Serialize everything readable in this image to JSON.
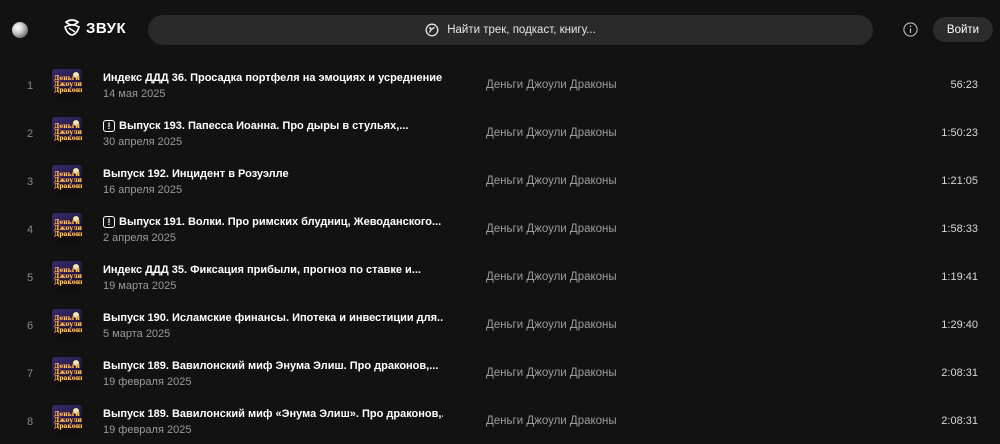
{
  "header": {
    "logo_text": "ЗВУК",
    "search_placeholder": "Найти трек, подкаст, книгу...",
    "login_label": "Войти"
  },
  "tracks": [
    {
      "num": "1",
      "title": "Индекс ДДД 36. Просадка портфеля на эмоциях и усреднение",
      "explicit": false,
      "date": "14 мая 2025",
      "artist": "Деньги Джоули Драконы",
      "duration": "56:23"
    },
    {
      "num": "2",
      "title": "Выпуск 193. Папесса Иоанна. Про дыры в стульях,...",
      "explicit": true,
      "date": "30 апреля 2025",
      "artist": "Деньги Джоули Драконы",
      "duration": "1:50:23"
    },
    {
      "num": "3",
      "title": "Выпуск 192. Инцидент в Розуэлле",
      "explicit": false,
      "date": "16 апреля 2025",
      "artist": "Деньги Джоули Драконы",
      "duration": "1:21:05"
    },
    {
      "num": "4",
      "title": "Выпуск 191. Волки. Про римских блудниц, Жеводанского...",
      "explicit": true,
      "date": "2 апреля 2025",
      "artist": "Деньги Джоули Драконы",
      "duration": "1:58:33"
    },
    {
      "num": "5",
      "title": "Индекс ДДД 35. Фиксация прибыли, прогноз по ставке и...",
      "explicit": false,
      "date": "19 марта 2025",
      "artist": "Деньги Джоули Драконы",
      "duration": "1:19:41"
    },
    {
      "num": "6",
      "title": "Выпуск 190. Исламские финансы. Ипотека и инвестиции для...",
      "explicit": false,
      "date": "5 марта 2025",
      "artist": "Деньги Джоули Драконы",
      "duration": "1:29:40"
    },
    {
      "num": "7",
      "title": "Выпуск 189. Вавилонский миф Энума Элиш. Про драконов,...",
      "explicit": false,
      "date": "19 февраля 2025",
      "artist": "Деньги Джоули Драконы",
      "duration": "2:08:31"
    },
    {
      "num": "8",
      "title": "Выпуск 189. Вавилонский миф «Энума Элиш». Про драконов,...",
      "explicit": false,
      "date": "19 февраля 2025",
      "artist": "Деньги Джоули Драконы",
      "duration": "2:08:31"
    }
  ],
  "cover_art": {
    "caption_lines": [
      "Деньги",
      "Джоули",
      "Драконы"
    ],
    "icon": "podcast-cover-image"
  },
  "colors": {
    "background": "#121212",
    "search_bg": "#2a2a2a",
    "muted_text": "#9c9c9c",
    "cover_caption": "#ffd25a"
  }
}
